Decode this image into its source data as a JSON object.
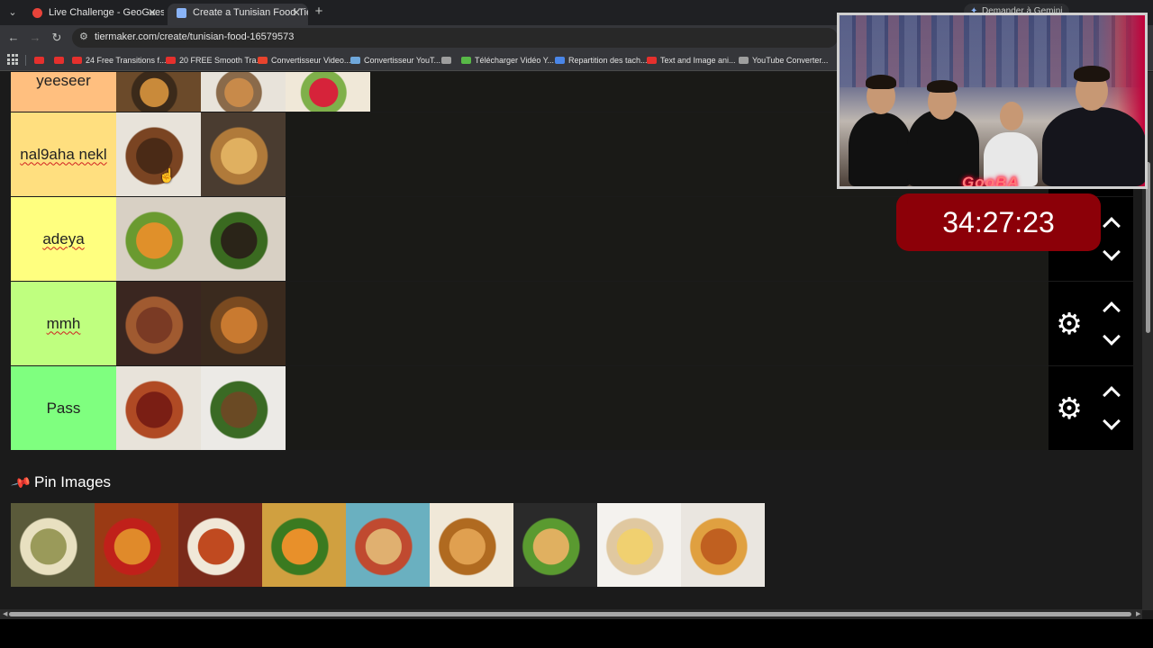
{
  "browser": {
    "tabs": [
      {
        "title": "Live Challenge - GeoGuessr",
        "close": "✕",
        "icon_color": "#e8433a",
        "active": false
      },
      {
        "title": "Create a Tunisian Food Tier List",
        "close": "✕",
        "icon_color": "#8ab4f8",
        "active": true
      }
    ],
    "new_tab": "+",
    "gemini_label": "Demander à Gemini",
    "url": "tiermaker.com/create/tunisian-food-16579573",
    "bookmarks": [
      {
        "label": "",
        "icon_color": "#e5302d"
      },
      {
        "label": "",
        "icon_color": "#e5302d"
      },
      {
        "label": "24 Free Transitions f...",
        "icon_color": "#e5302d"
      },
      {
        "label": "20 FREE Smooth Tra...",
        "icon_color": "#e5302d"
      },
      {
        "label": "Convertisseur Video...",
        "icon_color": "#e8432d"
      },
      {
        "label": "Convertisseur YouT...",
        "icon_color": "#6fa8dc"
      },
      {
        "label": "",
        "icon_color": "#9e9e9e"
      },
      {
        "label": "Télécharger Vidéo Y...",
        "icon_color": "#58b947"
      },
      {
        "label": "Repartition des tach...",
        "icon_color": "#4a86e8"
      },
      {
        "label": "Text and Image ani...",
        "icon_color": "#e5302d"
      },
      {
        "label": "YouTube Converter...",
        "icon_color": "#9e9e9e"
      }
    ]
  },
  "tiers": [
    {
      "label": "yeeseer",
      "color": "#ffbf7f",
      "spellcheck": false,
      "images": [
        "spaghetti-with-meat",
        "soup-bowl",
        "tomato-salad"
      ]
    },
    {
      "label": "nal9aha nekl",
      "color": "#ffdf7f",
      "spellcheck": true,
      "images": [
        "grilled-meat-plate",
        "brik-pastry"
      ]
    },
    {
      "label": "adeya",
      "color": "#ffff7f",
      "spellcheck": true,
      "images": [
        "couscous-with-vegetables",
        "mloukhia-stew"
      ]
    },
    {
      "label": "mmh",
      "color": "#bfff7f",
      "spellcheck": true,
      "images": [
        "meatballs-in-sauce",
        "lamb-with-rice"
      ]
    },
    {
      "label": "Pass",
      "color": "#7fff7f",
      "spellcheck": false,
      "images": [
        "chickpea-stew",
        "rice-dish"
      ]
    }
  ],
  "pin_images": {
    "title": "Pin Images",
    "items": [
      "green-rice-dish",
      "stew-with-peppers",
      "shakshuka",
      "couscous-plate",
      "wrap-sandwich",
      "layered-pastry",
      "baguette-sandwich",
      "crepe",
      "fried-bread-sandwich"
    ]
  },
  "overlay": {
    "timer": "34:27:23",
    "streamer_logo": "GooBA"
  }
}
